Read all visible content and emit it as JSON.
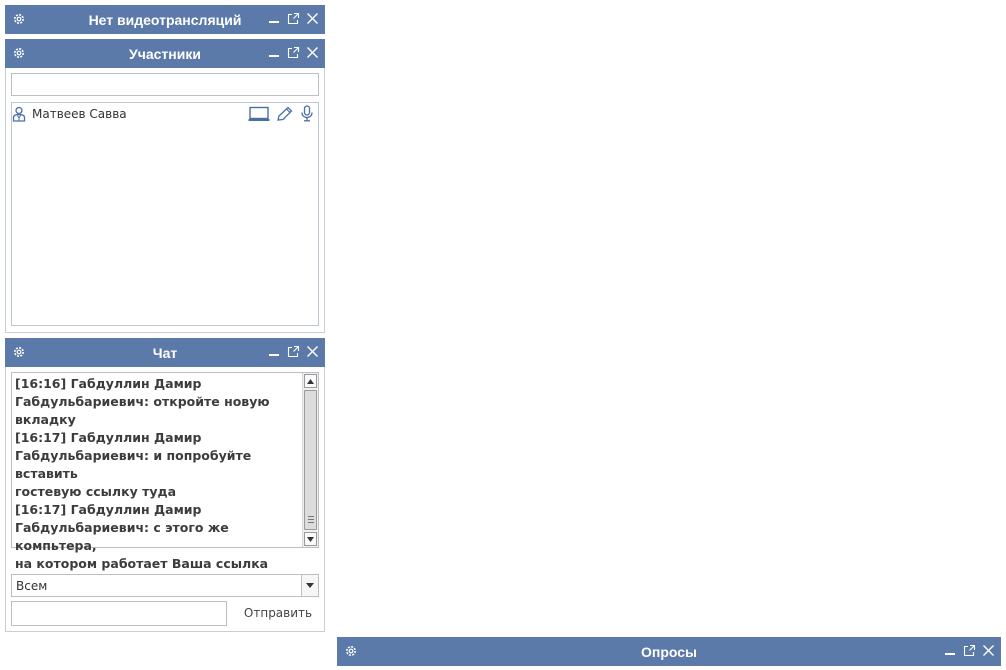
{
  "video_panel": {
    "title": "Нет видеотрансляций"
  },
  "participants_panel": {
    "title": "Участники",
    "search_value": "",
    "participants": [
      {
        "name": "Матвеев Савва"
      }
    ]
  },
  "chat_panel": {
    "title": "Чат",
    "lines": [
      "[16:16] Габдуллин Дамир",
      "Габдульбариевич: откройте новую",
      "вкладку",
      "[16:17] Габдуллин Дамир",
      "Габдульбариевич: и попробуйте вставить",
      "гостевую ссылку туда",
      "[16:17] Габдуллин Дамир",
      "Габдульбариевич: с этого же компьтера,",
      "на котором работает Ваша ссылка"
    ],
    "recipient": "Всем",
    "message_value": "",
    "send_label": "Отправить"
  },
  "polls_panel": {
    "title": "Опросы"
  },
  "colors": {
    "titlebar": "#5b7aa9",
    "icon_blue": "#4a6fa5"
  }
}
